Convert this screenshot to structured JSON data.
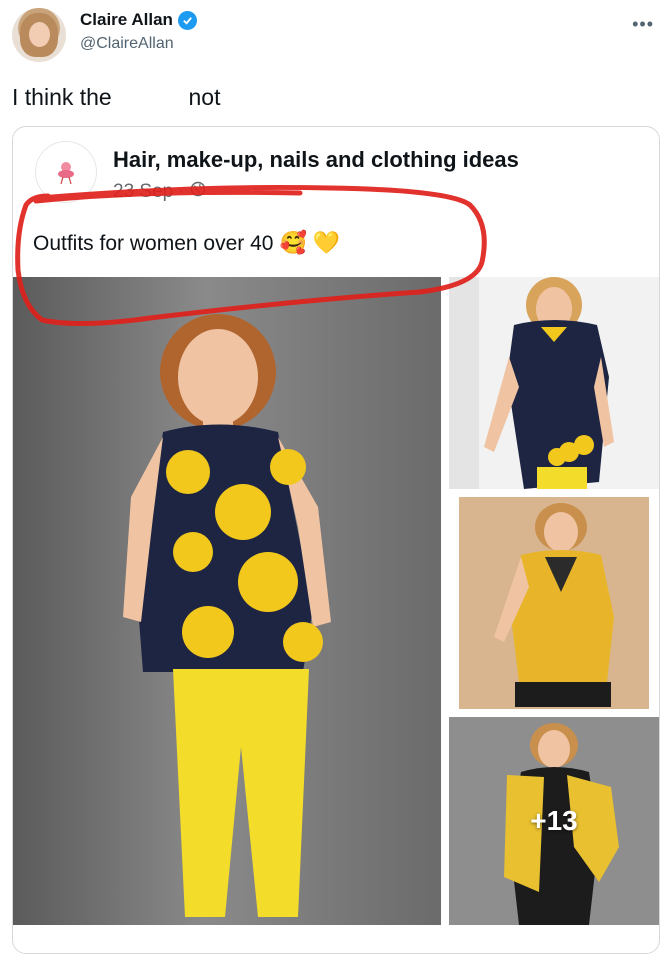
{
  "tweet": {
    "display_name": "Claire Allan",
    "handle": "@ClaireAllan",
    "more_icon": "more-horizontal-icon",
    "text_before": "I think the",
    "text_after": "not"
  },
  "post": {
    "page_name": "Hair, make-up, nails and clothing ideas",
    "date": "23 Sep",
    "separator": "·",
    "caption": "Outfits for women over 40",
    "emojis": [
      "🥰",
      "💛"
    ],
    "more_photos": "+13"
  },
  "colors": {
    "verified": "#1d9bf0",
    "annotation_red": "#e0211b",
    "handle_grey": "#536471",
    "yellow": "#f2c81d",
    "navy": "#1e2543"
  },
  "icons": [
    "verified-badge-icon",
    "globe-icon",
    "more-horizontal-icon"
  ]
}
